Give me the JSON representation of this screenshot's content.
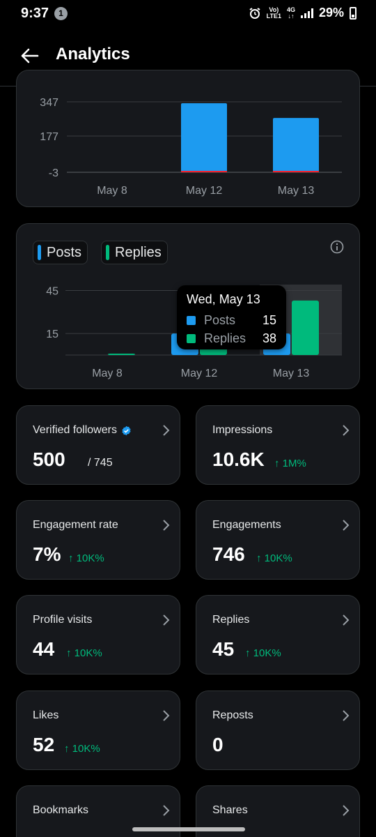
{
  "status_bar": {
    "time": "9:37",
    "notification_count": "1",
    "network_top": "Vo)",
    "network_bottom": "LTE1",
    "net_type": "4G",
    "battery": "29%"
  },
  "header": {
    "title": "Analytics"
  },
  "colors": {
    "posts": "#1d9bf0",
    "replies": "#00ba7c",
    "red_line": "#f4212e",
    "delta": "#00ba7c"
  },
  "chart_data": [
    {
      "type": "bar",
      "categories": [
        "May 8",
        "May 12",
        "May 13"
      ],
      "yticks": [
        "347",
        "177",
        "-3"
      ],
      "ylim": [
        -3,
        347
      ],
      "series": [
        {
          "values": [
            0,
            340,
            267
          ],
          "color": "#1d9bf0"
        }
      ],
      "grid": true
    },
    {
      "type": "bar",
      "categories": [
        "May 8",
        "May 12",
        "May 13"
      ],
      "yticks": [
        "45",
        "15"
      ],
      "series": [
        {
          "name": "Posts",
          "values": [
            0,
            15,
            15
          ]
        },
        {
          "name": "Replies",
          "values": [
            1,
            15,
            38
          ]
        }
      ],
      "tooltip": {
        "title": "Wed, May 13",
        "rows": [
          {
            "name": "Posts",
            "value": "15"
          },
          {
            "name": "Replies",
            "value": "38"
          }
        ]
      },
      "grid": true
    }
  ],
  "legend": {
    "posts": "Posts",
    "replies": "Replies"
  },
  "stats": [
    {
      "label": "Verified followers",
      "value": "500",
      "sub": "/ 745"
    },
    {
      "label": "Impressions",
      "value": "10.6K",
      "delta": "↑ 1M%"
    },
    {
      "label": "Engagement rate",
      "value": "7%",
      "delta": "↑ 10K%"
    },
    {
      "label": "Engagements",
      "value": "746",
      "delta": "↑ 10K%"
    },
    {
      "label": "Profile visits",
      "value": "44",
      "delta": "↑ 10K%"
    },
    {
      "label": "Replies",
      "value": "45",
      "delta": "↑ 10K%"
    },
    {
      "label": "Likes",
      "value": "52",
      "delta": "↑ 10K%"
    },
    {
      "label": "Reposts",
      "value": "0"
    },
    {
      "label": "Bookmarks"
    },
    {
      "label": "Shares"
    }
  ]
}
